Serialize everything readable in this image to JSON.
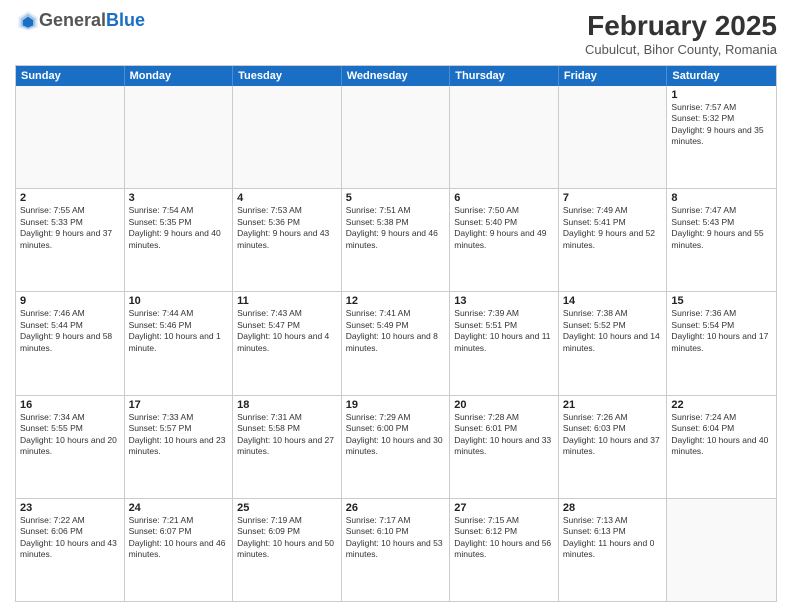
{
  "header": {
    "logo_general": "General",
    "logo_blue": "Blue",
    "month_year": "February 2025",
    "location": "Cubulcut, Bihor County, Romania"
  },
  "day_headers": [
    "Sunday",
    "Monday",
    "Tuesday",
    "Wednesday",
    "Thursday",
    "Friday",
    "Saturday"
  ],
  "weeks": [
    [
      {
        "num": "",
        "info": ""
      },
      {
        "num": "",
        "info": ""
      },
      {
        "num": "",
        "info": ""
      },
      {
        "num": "",
        "info": ""
      },
      {
        "num": "",
        "info": ""
      },
      {
        "num": "",
        "info": ""
      },
      {
        "num": "1",
        "info": "Sunrise: 7:57 AM\nSunset: 5:32 PM\nDaylight: 9 hours and 35 minutes."
      }
    ],
    [
      {
        "num": "2",
        "info": "Sunrise: 7:55 AM\nSunset: 5:33 PM\nDaylight: 9 hours and 37 minutes."
      },
      {
        "num": "3",
        "info": "Sunrise: 7:54 AM\nSunset: 5:35 PM\nDaylight: 9 hours and 40 minutes."
      },
      {
        "num": "4",
        "info": "Sunrise: 7:53 AM\nSunset: 5:36 PM\nDaylight: 9 hours and 43 minutes."
      },
      {
        "num": "5",
        "info": "Sunrise: 7:51 AM\nSunset: 5:38 PM\nDaylight: 9 hours and 46 minutes."
      },
      {
        "num": "6",
        "info": "Sunrise: 7:50 AM\nSunset: 5:40 PM\nDaylight: 9 hours and 49 minutes."
      },
      {
        "num": "7",
        "info": "Sunrise: 7:49 AM\nSunset: 5:41 PM\nDaylight: 9 hours and 52 minutes."
      },
      {
        "num": "8",
        "info": "Sunrise: 7:47 AM\nSunset: 5:43 PM\nDaylight: 9 hours and 55 minutes."
      }
    ],
    [
      {
        "num": "9",
        "info": "Sunrise: 7:46 AM\nSunset: 5:44 PM\nDaylight: 9 hours and 58 minutes."
      },
      {
        "num": "10",
        "info": "Sunrise: 7:44 AM\nSunset: 5:46 PM\nDaylight: 10 hours and 1 minute."
      },
      {
        "num": "11",
        "info": "Sunrise: 7:43 AM\nSunset: 5:47 PM\nDaylight: 10 hours and 4 minutes."
      },
      {
        "num": "12",
        "info": "Sunrise: 7:41 AM\nSunset: 5:49 PM\nDaylight: 10 hours and 8 minutes."
      },
      {
        "num": "13",
        "info": "Sunrise: 7:39 AM\nSunset: 5:51 PM\nDaylight: 10 hours and 11 minutes."
      },
      {
        "num": "14",
        "info": "Sunrise: 7:38 AM\nSunset: 5:52 PM\nDaylight: 10 hours and 14 minutes."
      },
      {
        "num": "15",
        "info": "Sunrise: 7:36 AM\nSunset: 5:54 PM\nDaylight: 10 hours and 17 minutes."
      }
    ],
    [
      {
        "num": "16",
        "info": "Sunrise: 7:34 AM\nSunset: 5:55 PM\nDaylight: 10 hours and 20 minutes."
      },
      {
        "num": "17",
        "info": "Sunrise: 7:33 AM\nSunset: 5:57 PM\nDaylight: 10 hours and 23 minutes."
      },
      {
        "num": "18",
        "info": "Sunrise: 7:31 AM\nSunset: 5:58 PM\nDaylight: 10 hours and 27 minutes."
      },
      {
        "num": "19",
        "info": "Sunrise: 7:29 AM\nSunset: 6:00 PM\nDaylight: 10 hours and 30 minutes."
      },
      {
        "num": "20",
        "info": "Sunrise: 7:28 AM\nSunset: 6:01 PM\nDaylight: 10 hours and 33 minutes."
      },
      {
        "num": "21",
        "info": "Sunrise: 7:26 AM\nSunset: 6:03 PM\nDaylight: 10 hours and 37 minutes."
      },
      {
        "num": "22",
        "info": "Sunrise: 7:24 AM\nSunset: 6:04 PM\nDaylight: 10 hours and 40 minutes."
      }
    ],
    [
      {
        "num": "23",
        "info": "Sunrise: 7:22 AM\nSunset: 6:06 PM\nDaylight: 10 hours and 43 minutes."
      },
      {
        "num": "24",
        "info": "Sunrise: 7:21 AM\nSunset: 6:07 PM\nDaylight: 10 hours and 46 minutes."
      },
      {
        "num": "25",
        "info": "Sunrise: 7:19 AM\nSunset: 6:09 PM\nDaylight: 10 hours and 50 minutes."
      },
      {
        "num": "26",
        "info": "Sunrise: 7:17 AM\nSunset: 6:10 PM\nDaylight: 10 hours and 53 minutes."
      },
      {
        "num": "27",
        "info": "Sunrise: 7:15 AM\nSunset: 6:12 PM\nDaylight: 10 hours and 56 minutes."
      },
      {
        "num": "28",
        "info": "Sunrise: 7:13 AM\nSunset: 6:13 PM\nDaylight: 11 hours and 0 minutes."
      },
      {
        "num": "",
        "info": ""
      }
    ]
  ]
}
